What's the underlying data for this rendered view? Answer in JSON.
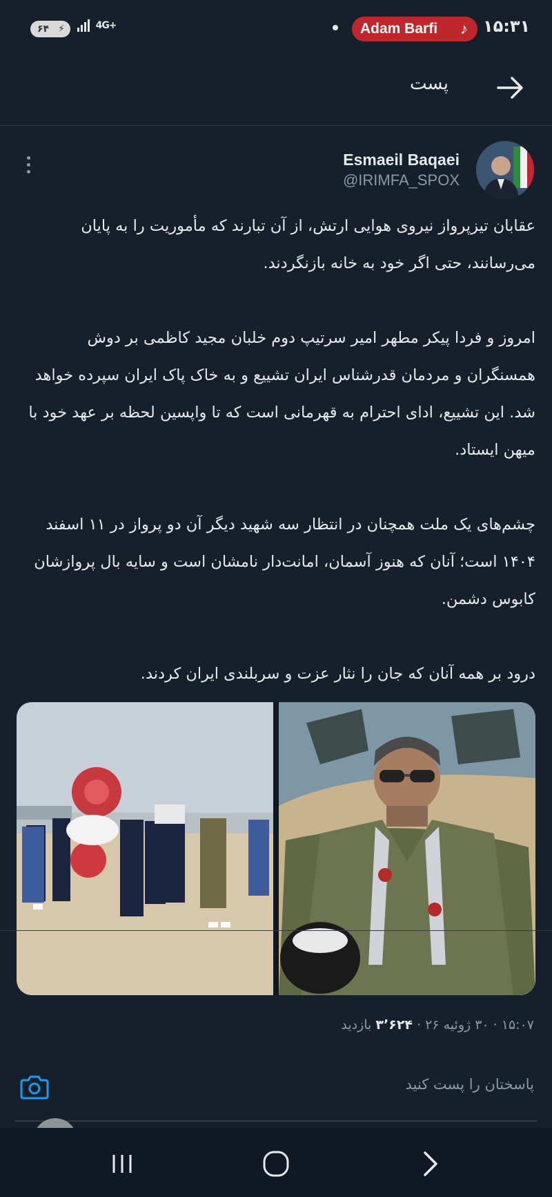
{
  "status_bar": {
    "battery": "۶۴",
    "network": "4G+",
    "now_playing": "Adam Barfi",
    "time": "۱۵:۳۱"
  },
  "header": {
    "title": "پست",
    "back_icon": "arrow-right-icon"
  },
  "post": {
    "author_name": "Esmaeil Baqaei",
    "author_handle": "@IRIMFA_SPOX",
    "paragraphs": [
      "عقابان تیزپرواز نیروی هوایی ارتش، از آن تبارند که مأموریت را به پایان می‌رسانند، حتی اگر خود به خانه بازنگردند.",
      "امروز و فردا پیکر مطهر امیر سرتیپ دوم خلبان مجید کاظمی بر دوش همسنگران و مردمان قدرشناس ایران تشییع و به خاک پاک ایران سپرده خواهد شد. این تشییع، ادای احترام به قهرمانی است که تا واپسین لحظه بر عهد خود با میهن ایستاد.",
      "چشم‌های یک ملت همچنان در انتظار سه شهید دیگر آن دو پرواز در ۱۱ اسفند ۱۴۰۴ است؛ آنان که هنوز آسمان، امانت‌دار نامشان است و سایه بال پروازشان کابوس دشمن.",
      "درود بر همه آنان که جان را نثار عزت و سربلندی ایران کردند."
    ],
    "meta_time": "۱۵:۰۷ · ۳۰ ژوئیه ۲۶ ·",
    "views_count": "۳٬۶۲۴",
    "views_label": "بازدید"
  },
  "reply": {
    "placeholder": "پاسختان را پست کنید"
  },
  "colors": {
    "background": "#15202b",
    "accent": "#1d9bf0",
    "music_pill": "#c0272d"
  }
}
